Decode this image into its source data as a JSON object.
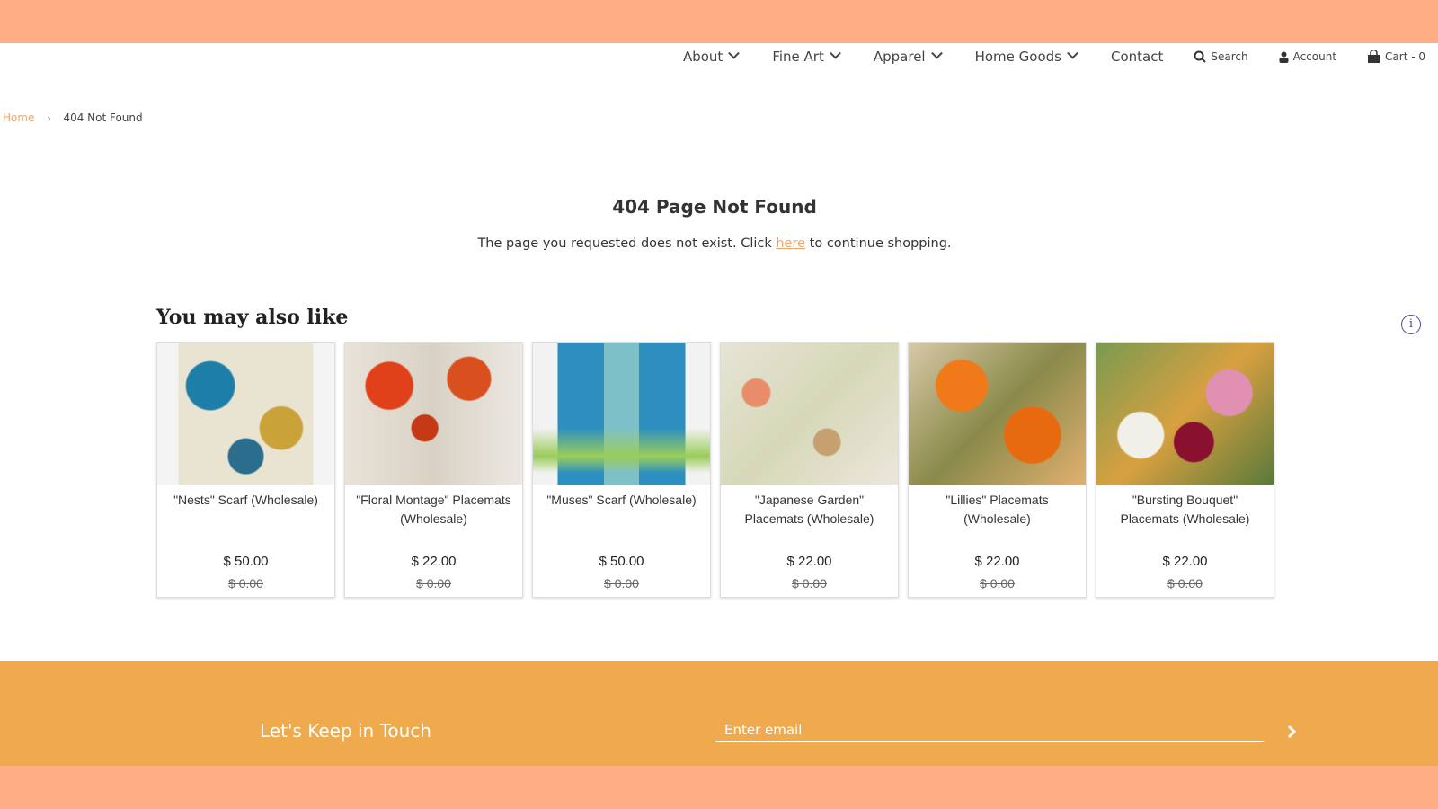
{
  "nav": {
    "items": [
      {
        "label": "About"
      },
      {
        "label": "Fine Art"
      },
      {
        "label": "Apparel"
      },
      {
        "label": "Home Goods"
      }
    ],
    "contact": "Contact",
    "search": "Search",
    "account": "Account",
    "cart": "Cart - 0"
  },
  "breadcrumb": {
    "home": "Home",
    "separator": "›",
    "current": "404 Not Found"
  },
  "main": {
    "title": "404 Page Not Found",
    "msg_before": "The page you requested does not exist. Click ",
    "msg_link": "here",
    "msg_after": " to continue shopping."
  },
  "recommendations": {
    "heading": "You may also like",
    "products": [
      {
        "name": "\"Nests\" Scarf (Wholesale)",
        "price": "$ 50.00",
        "compare": "$ 0.00"
      },
      {
        "name": "\"Floral Montage\" Placemats (Wholesale)",
        "price": "$ 22.00",
        "compare": "$ 0.00"
      },
      {
        "name": "\"Muses\" Scarf (Wholesale)",
        "price": "$ 50.00",
        "compare": "$ 0.00"
      },
      {
        "name": "\"Japanese Garden\" Placemats (Wholesale)",
        "price": "$ 22.00",
        "compare": "$ 0.00"
      },
      {
        "name": "\"Lillies\" Placemats (Wholesale)",
        "price": "$ 22.00",
        "compare": "$ 0.00"
      },
      {
        "name": "\"Bursting Bouquet\" Placemats (Wholesale)",
        "price": "$ 22.00",
        "compare": "$ 0.00"
      }
    ]
  },
  "footer": {
    "title": "Let's Keep in Touch",
    "email_placeholder": "Enter email"
  },
  "colors": {
    "band": "#ffad85",
    "footer": "#eeaa4d",
    "link": "#f0a46b"
  }
}
